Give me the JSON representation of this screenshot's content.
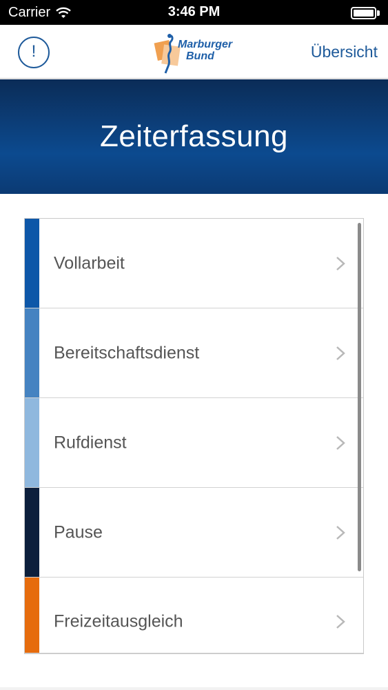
{
  "status_bar": {
    "carrier": "Carrier",
    "time": "3:46 PM"
  },
  "nav_bar": {
    "info_label": "!",
    "logo_line1": "Marburger",
    "logo_line2": "Bund",
    "overview_label": "Übersicht"
  },
  "header": {
    "title": "Zeiterfassung"
  },
  "categories": [
    {
      "label": "Vollarbeit",
      "color": "#0d57a8"
    },
    {
      "label": "Bereitschaftsdienst",
      "color": "#4583c1"
    },
    {
      "label": "Rufdienst",
      "color": "#8fb8de"
    },
    {
      "label": "Pause",
      "color": "#0c1f3c"
    },
    {
      "label": "Freizeitausgleich",
      "color": "#e66c0d"
    }
  ],
  "colors": {
    "accent": "#1e5a9a",
    "logo_orange": "#f0a050"
  }
}
